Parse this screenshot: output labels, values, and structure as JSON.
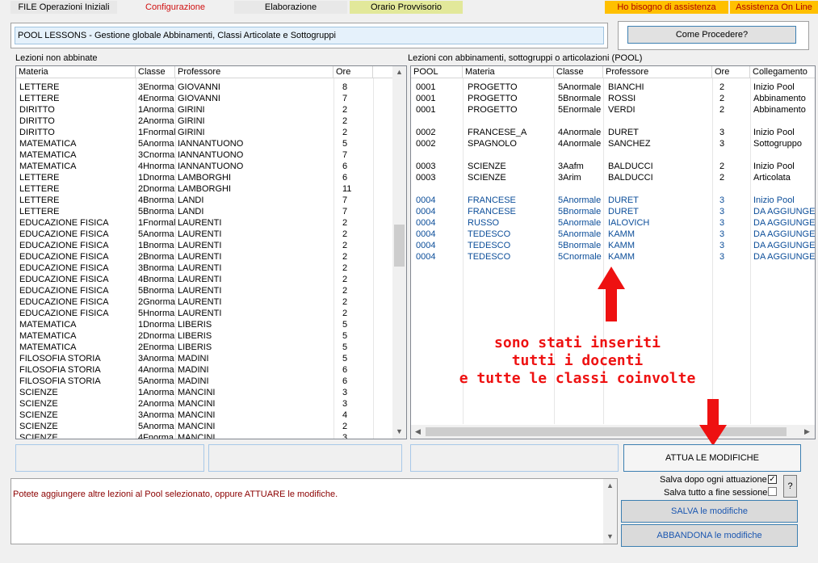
{
  "menu": {
    "file": "FILE Operazioni Iniziali",
    "configurazione": "Configurazione",
    "elaborazione": "Elaborazione",
    "orario": "Orario Provvisorio",
    "assistenza": "Ho bisogno di assistenza",
    "assistenza_online": "Assistenza On Line"
  },
  "title": "POOL LESSONS - Gestione globale Abbinamenti, Classi Articolate e Sottogruppi",
  "come_procedere": "Come  Procedere?",
  "left": {
    "caption": "Lezioni non abbinate",
    "headers": [
      "Materia",
      "Classe",
      "Professore",
      "Ore"
    ],
    "rows": [
      [
        "LETTERE",
        "3Enorma",
        "GIOVANNI",
        "8"
      ],
      [
        "LETTERE",
        "4Enorma",
        "GIOVANNI",
        "7"
      ],
      [
        "DIRITTO",
        "1Anorma",
        "GIRINI",
        "2"
      ],
      [
        "DIRITTO",
        "2Anorma",
        "GIRINI",
        "2"
      ],
      [
        "DIRITTO",
        "1Fnormal",
        "GIRINI",
        "2"
      ],
      [
        "MATEMATICA",
        "5Anorma",
        "IANNANTUONO",
        "5"
      ],
      [
        "MATEMATICA",
        "3Cnorma",
        "IANNANTUONO",
        "7"
      ],
      [
        "MATEMATICA",
        "4Hnorma",
        "IANNANTUONO",
        "6"
      ],
      [
        "LETTERE",
        "1Dnorma",
        "LAMBORGHI",
        "6"
      ],
      [
        "LETTERE",
        "2Dnorma",
        "LAMBORGHI",
        "11"
      ],
      [
        "LETTERE",
        "4Bnorma",
        "LANDI",
        "7"
      ],
      [
        "LETTERE",
        "5Bnorma",
        "LANDI",
        "7"
      ],
      [
        "EDUCAZIONE FISICA",
        "1Fnormal",
        "LAURENTI",
        "2"
      ],
      [
        "EDUCAZIONE FISICA",
        "5Anorma",
        "LAURENTI",
        "2"
      ],
      [
        "EDUCAZIONE FISICA",
        "1Bnorma",
        "LAURENTI",
        "2"
      ],
      [
        "EDUCAZIONE FISICA",
        "2Bnorma",
        "LAURENTI",
        "2"
      ],
      [
        "EDUCAZIONE FISICA",
        "3Bnorma",
        "LAURENTI",
        "2"
      ],
      [
        "EDUCAZIONE FISICA",
        "4Bnorma",
        "LAURENTI",
        "2"
      ],
      [
        "EDUCAZIONE FISICA",
        "5Bnorma",
        "LAURENTI",
        "2"
      ],
      [
        "EDUCAZIONE FISICA",
        "2Gnorma",
        "LAURENTI",
        "2"
      ],
      [
        "EDUCAZIONE FISICA",
        "5Hnorma",
        "LAURENTI",
        "2"
      ],
      [
        "MATEMATICA",
        "1Dnorma",
        "LIBERIS",
        "5"
      ],
      [
        "MATEMATICA",
        "2Dnorma",
        "LIBERIS",
        "5"
      ],
      [
        "MATEMATICA",
        "2Enorma",
        "LIBERIS",
        "5"
      ],
      [
        "FILOSOFIA STORIA",
        "3Anorma",
        "MADINI",
        "5"
      ],
      [
        "FILOSOFIA STORIA",
        "4Anorma",
        "MADINI",
        "6"
      ],
      [
        "FILOSOFIA STORIA",
        "5Anorma",
        "MADINI",
        "6"
      ],
      [
        "SCIENZE",
        "1Anorma",
        "MANCINI",
        "3"
      ],
      [
        "SCIENZE",
        "2Anorma",
        "MANCINI",
        "3"
      ],
      [
        "SCIENZE",
        "3Anorma",
        "MANCINI",
        "4"
      ],
      [
        "SCIENZE",
        "5Anorma",
        "MANCINI",
        "2"
      ],
      [
        "SCIENZE",
        "4Fnorma",
        "MANCINI",
        "3"
      ]
    ]
  },
  "right": {
    "caption": "Lezioni con abbinamenti, sottogruppi o articolazioni (POOL)",
    "headers": [
      "POOL",
      "Materia",
      "Classe",
      "Professore",
      "Ore",
      "Collegamento"
    ],
    "rows": [
      {
        "cells": [
          "0001",
          "PROGETTO",
          "5Anormale",
          "BIANCHI",
          "2",
          "Inizio Pool"
        ],
        "blue": false
      },
      {
        "cells": [
          "0001",
          "PROGETTO",
          "5Bnormale",
          "ROSSI",
          "2",
          "Abbinamento"
        ],
        "blue": false
      },
      {
        "cells": [
          "0001",
          "PROGETTO",
          "5Enormale",
          "VERDI",
          "2",
          "Abbinamento"
        ],
        "blue": false
      },
      {
        "cells": [
          "",
          "",
          "",
          "",
          "",
          ""
        ],
        "blue": false
      },
      {
        "cells": [
          "0002",
          "FRANCESE_A",
          "4Anormale",
          "DURET",
          "3",
          "Inizio Pool"
        ],
        "blue": false
      },
      {
        "cells": [
          "0002",
          "SPAGNOLO",
          "4Anormale",
          "SANCHEZ",
          "3",
          "Sottogruppo"
        ],
        "blue": false
      },
      {
        "cells": [
          "",
          "",
          "",
          "",
          "",
          ""
        ],
        "blue": false
      },
      {
        "cells": [
          "0003",
          "SCIENZE",
          "3Aafm",
          "BALDUCCI",
          "2",
          "Inizio Pool"
        ],
        "blue": false
      },
      {
        "cells": [
          "0003",
          "SCIENZE",
          "3Arim",
          "BALDUCCI",
          "2",
          "Articolata"
        ],
        "blue": false
      },
      {
        "cells": [
          "",
          "",
          "",
          "",
          "",
          ""
        ],
        "blue": false
      },
      {
        "cells": [
          "0004",
          "FRANCESE",
          "5Anormale",
          "DURET",
          "3",
          "Inizio Pool"
        ],
        "blue": true
      },
      {
        "cells": [
          "0004",
          "FRANCESE",
          "5Bnormale",
          "DURET",
          "3",
          "DA AGGIUNGE"
        ],
        "blue": true
      },
      {
        "cells": [
          "0004",
          "RUSSO",
          "5Anormale",
          "IALOVICH",
          "3",
          "DA AGGIUNGE"
        ],
        "blue": true
      },
      {
        "cells": [
          "0004",
          "TEDESCO",
          "5Anormale",
          "KAMM",
          "3",
          "DA AGGIUNGE"
        ],
        "blue": true
      },
      {
        "cells": [
          "0004",
          "TEDESCO",
          "5Bnormale",
          "KAMM",
          "3",
          "DA AGGIUNGE"
        ],
        "blue": true
      },
      {
        "cells": [
          "0004",
          "TEDESCO",
          "5Cnormale",
          "KAMM",
          "3",
          "DA AGGIUNGE"
        ],
        "blue": true
      }
    ]
  },
  "annotation": {
    "line1": "sono stati inseriti",
    "line2": "tutti i docenti",
    "line3": "e tutte le classi coinvolte"
  },
  "attua_button": "ATTUA LE MODIFICHE",
  "message": "Potete aggiungere altre lezioni al Pool selezionato, oppure ATTUARE le modifiche.",
  "options": {
    "salva_dopo": "Salva dopo ogni attuazione",
    "salva_dopo_checked": true,
    "salva_fine": "Salva tutto a fine sessione",
    "salva_fine_checked": false,
    "help": "?"
  },
  "salva_button": "SALVA le modifiche",
  "abbandona_button": "ABBANDONA le modifiche",
  "colors": {
    "accent_blue": "#0b4d99",
    "menu_yellow": "#ffc000",
    "menu_lime": "#e2e89a",
    "annotation_red": "#ee1111",
    "message_red": "#8b0000"
  }
}
